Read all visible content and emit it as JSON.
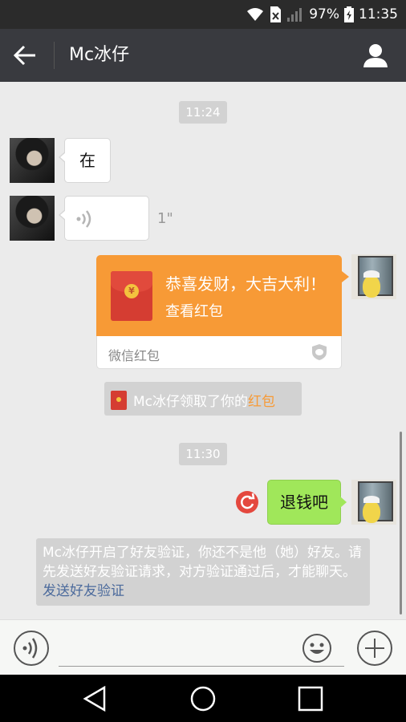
{
  "status_bar": {
    "battery_percent": "97%",
    "time": "11:35"
  },
  "title_bar": {
    "contact_name": "Mc冰仔"
  },
  "messages": {
    "time_1": "11:24",
    "text_1": "在",
    "voice_duration": "1\"",
    "red_packet": {
      "title": "恭喜发财，大吉大利！",
      "subtitle": "查看红包",
      "brand": "微信红包",
      "coin_symbol": "¥"
    },
    "system_claim": {
      "prefix": "Mc冰仔领取了你的",
      "link": "红包"
    },
    "time_2": "11:30",
    "sent_text": "退钱吧",
    "system_verify": {
      "text": "Mc冰仔开启了好友验证，你还不是他（她）好友。请先发送好友验证请求，对方验证通过后，才能聊天。",
      "link": "发送好友验证"
    }
  },
  "colors": {
    "titlebar": "#393a3f",
    "red_packet": "#f79a36",
    "sent_bubble": "#a0e75a",
    "link_blue": "#4b6a9c"
  }
}
